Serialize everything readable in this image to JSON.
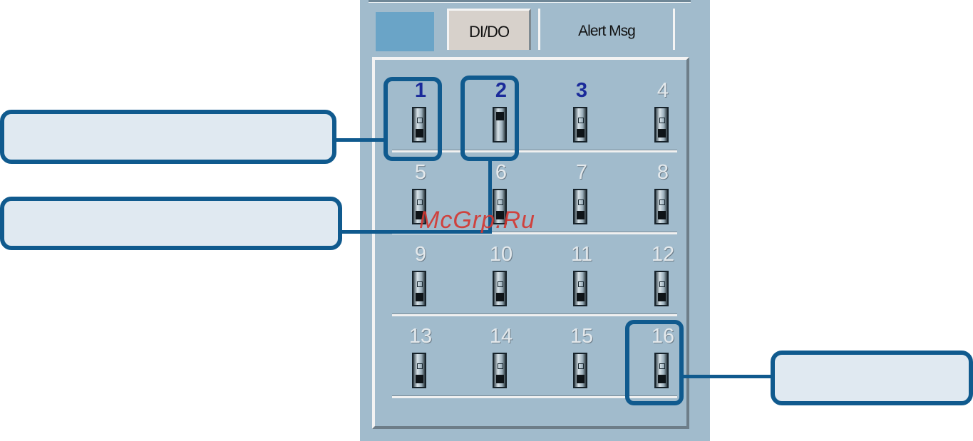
{
  "tabs": {
    "blank": "",
    "dido": "DI/DO",
    "alert": "Alert Msg"
  },
  "channels": [
    {
      "label": "1",
      "active": true,
      "state": "down"
    },
    {
      "label": "2",
      "active": true,
      "state": "up"
    },
    {
      "label": "3",
      "active": true,
      "state": "down"
    },
    {
      "label": "4",
      "active": false,
      "state": "down"
    },
    {
      "label": "5",
      "active": false,
      "state": "down"
    },
    {
      "label": "6",
      "active": false,
      "state": "down"
    },
    {
      "label": "7",
      "active": false,
      "state": "down"
    },
    {
      "label": "8",
      "active": false,
      "state": "down"
    },
    {
      "label": "9",
      "active": false,
      "state": "down"
    },
    {
      "label": "10",
      "active": false,
      "state": "down"
    },
    {
      "label": "11",
      "active": false,
      "state": "down"
    },
    {
      "label": "12",
      "active": false,
      "state": "down"
    },
    {
      "label": "13",
      "active": false,
      "state": "down"
    },
    {
      "label": "14",
      "active": false,
      "state": "down"
    },
    {
      "label": "15",
      "active": false,
      "state": "down"
    },
    {
      "label": "16",
      "active": false,
      "state": "down"
    }
  ],
  "watermark": "McGrp.Ru",
  "colors": {
    "panel": "#a1bbcc",
    "callout_border": "#105a8e",
    "active_number": "#1a2a9a"
  }
}
